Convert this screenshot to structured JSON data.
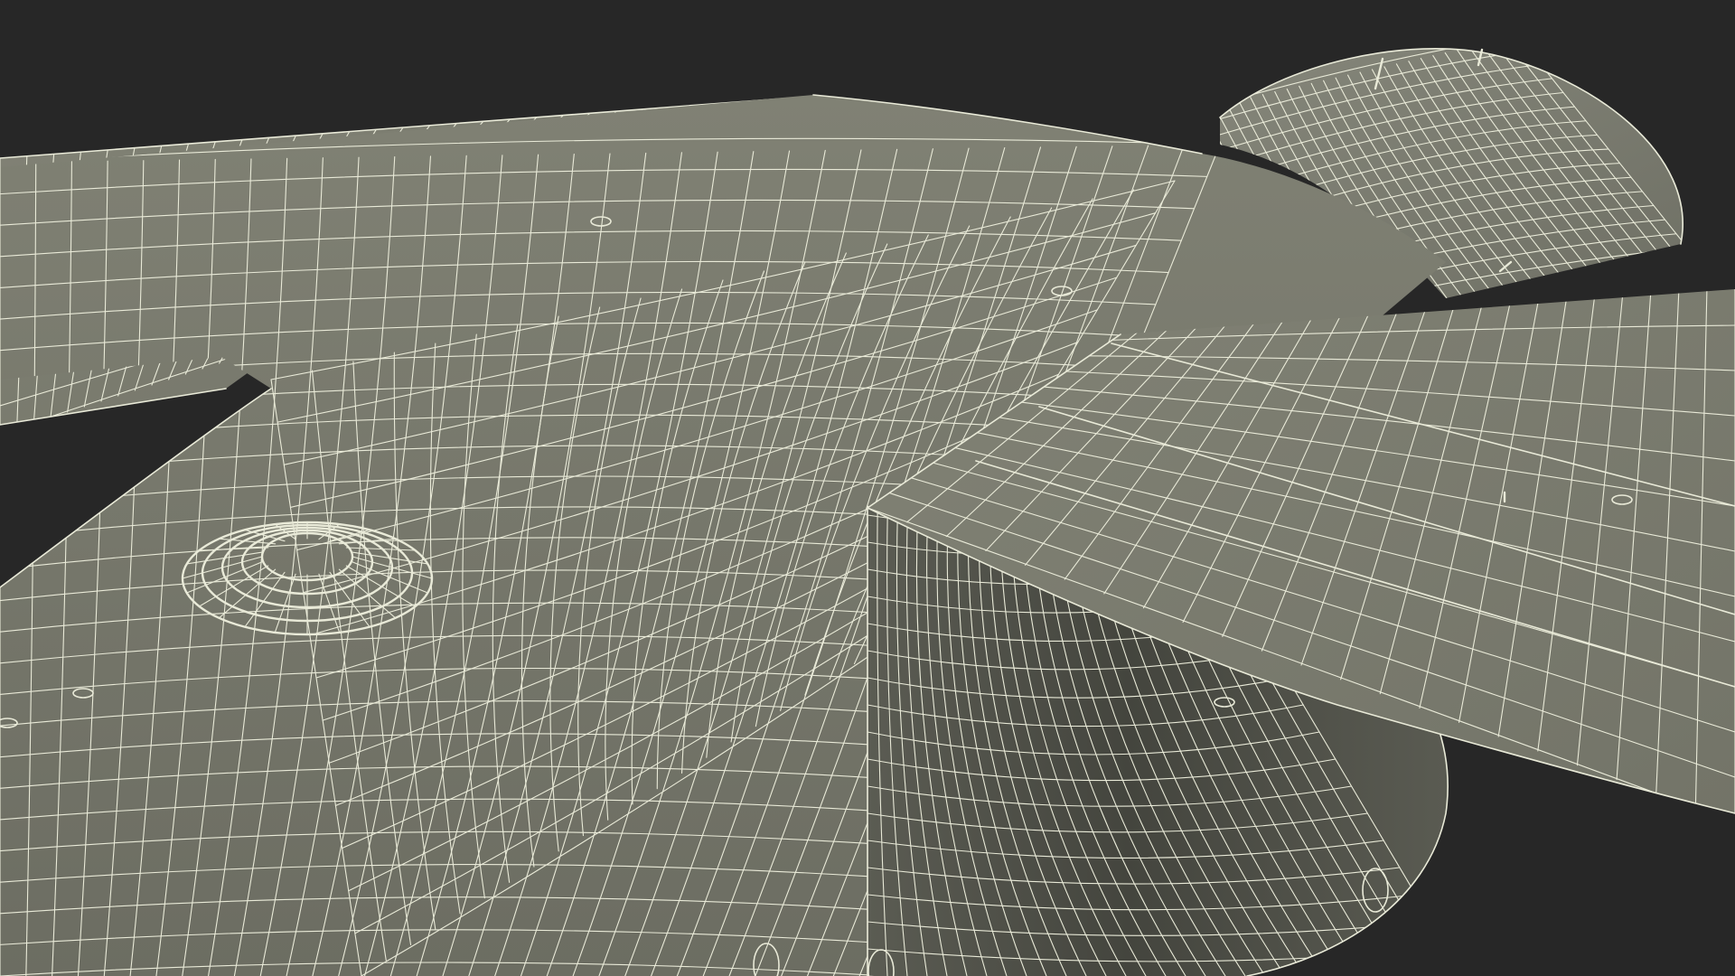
{
  "scene": {
    "subject": "wireframe-aircraft-model",
    "colors": {
      "background": "#272727",
      "surface_top": "#7c7d70",
      "surface_mid": "#6f7064",
      "surface_shadow": "#4a4b42",
      "surface_deep_shadow": "#3f403a",
      "wire": "#e9ead8"
    },
    "icons": {
      "dome": "sensor-dome-icon",
      "rivet": "rivet-icon",
      "antenna": "antenna-icon"
    }
  }
}
